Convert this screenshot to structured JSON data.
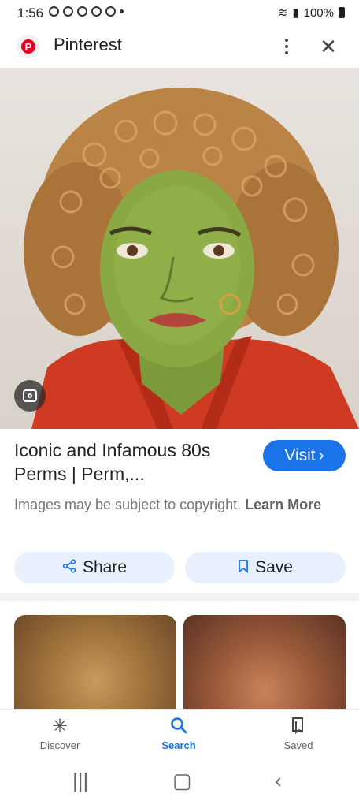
{
  "status_bar": {
    "time": "1:56",
    "battery": "100%"
  },
  "header": {
    "title": "Pinterest",
    "logo_letter": "P"
  },
  "result": {
    "title": "Iconic and Infamous 80s Perms | Perm,...",
    "visit_label": "Visit",
    "copyright_text": "Images may be subject to copyright.",
    "learn_more": "Learn More",
    "share_label": "Share",
    "save_label": "Save"
  },
  "bottom_nav": [
    {
      "label": "Discover",
      "icon": "asterisk-icon"
    },
    {
      "label": "Search",
      "icon": "search-icon"
    },
    {
      "label": "Saved",
      "icon": "bookmark-icon"
    }
  ],
  "colors": {
    "accent": "#1a73e8",
    "pinterest_red": "#e60023",
    "button_bg": "#e8f0fe"
  }
}
